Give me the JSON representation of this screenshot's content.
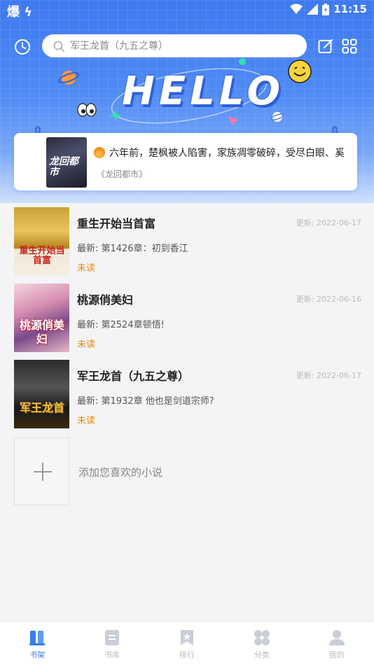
{
  "status_bar": {
    "left_icons": "爆 ϟ",
    "time": "11:15"
  },
  "header": {
    "search_placeholder": "军王龙首（九五之尊）",
    "hello": "HELLO"
  },
  "banner": {
    "cover_title": "龙回都市",
    "description": "六年前，楚枫被人陷害，家族凋零破碎，受尽白眼、奚",
    "book_name": "《龙回都市》"
  },
  "books": [
    {
      "title": "重生开始当首富",
      "update": "更新: 2022-06-17",
      "latest": "最新: 第1426章：初到香江",
      "status": "未读",
      "cover_text": "重生开始当首富"
    },
    {
      "title": "桃源俏美妇",
      "update": "更新: 2022-06-16",
      "latest": "最新: 第2524章顿悟!",
      "status": "未读",
      "cover_text": "桃源俏美妇"
    },
    {
      "title": "军王龙首（九五之尊）",
      "update": "更新: 2022-06-17",
      "latest": "最新: 第1932章 他也是剑道宗师?",
      "status": "未读",
      "cover_text": "军王龙首"
    }
  ],
  "add_book": "添加您喜欢的小说",
  "nav": [
    {
      "label": "书架",
      "icon": "bookshelf-icon",
      "active": true
    },
    {
      "label": "书库",
      "icon": "library-icon",
      "active": false
    },
    {
      "label": "排行",
      "icon": "ranking-icon",
      "active": false
    },
    {
      "label": "分类",
      "icon": "category-icon",
      "active": false
    },
    {
      "label": "我的",
      "icon": "profile-icon",
      "active": false
    }
  ],
  "colors": {
    "accent": "#3a7cf0",
    "unread": "#e8880c",
    "header_top": "#3e79f0"
  }
}
